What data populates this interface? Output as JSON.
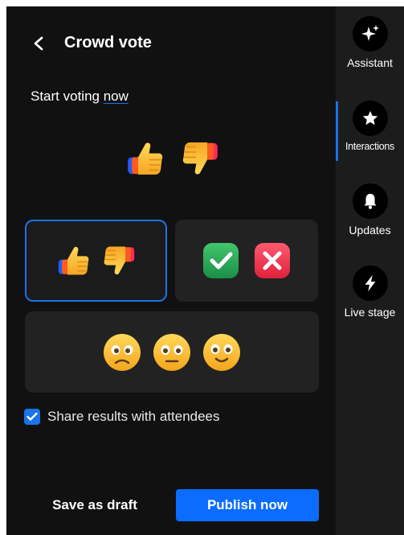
{
  "panel": {
    "title": "Crowd vote",
    "start_prefix": "Start voting ",
    "start_link": "now",
    "share_label": "Share results with attendees",
    "share_checked": true,
    "save_draft_label": "Save as draft",
    "publish_label": "Publish now"
  },
  "vote_options": [
    {
      "name": "thumbs",
      "icons": [
        "thumbs-up-icon",
        "thumbs-down-icon"
      ],
      "selected": true
    },
    {
      "name": "check-cross",
      "icons": [
        "check-icon",
        "cross-icon"
      ],
      "selected": false
    },
    {
      "name": "faces",
      "icons": [
        "frown-face-icon",
        "neutral-face-icon",
        "smile-face-icon"
      ],
      "selected": false
    }
  ],
  "rail": {
    "items": [
      {
        "label": "Assistant",
        "icon": "sparkle-icon",
        "active": false
      },
      {
        "label": "Interactions",
        "icon": "star-icon",
        "active": true
      },
      {
        "label": "Updates",
        "icon": "bell-icon",
        "active": false
      },
      {
        "label": "Live stage",
        "icon": "lightning-icon",
        "active": false
      }
    ]
  },
  "colors": {
    "accent": "#1a73e8",
    "publish": "#0b6cff",
    "panel_bg": "#111111",
    "card_bg": "#222222"
  }
}
